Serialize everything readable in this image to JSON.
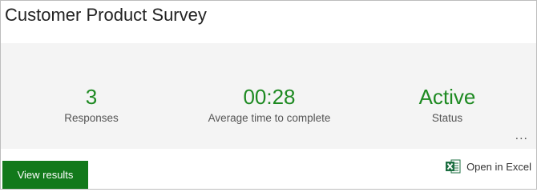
{
  "card": {
    "title": "Customer Product Survey"
  },
  "stats": [
    {
      "value": "3",
      "label": "Responses"
    },
    {
      "value": "00:28",
      "label": "Average time to complete"
    },
    {
      "value": "Active",
      "label": "Status"
    }
  ],
  "more_menu": {
    "glyph": "..."
  },
  "actions": {
    "view_results_label": "View results",
    "open_excel_label": "Open in Excel",
    "excel_icon": "excel-icon"
  },
  "colors": {
    "accent_green": "#1e8a22",
    "button_green": "#12791b",
    "excel_green": "#1d6f42"
  }
}
